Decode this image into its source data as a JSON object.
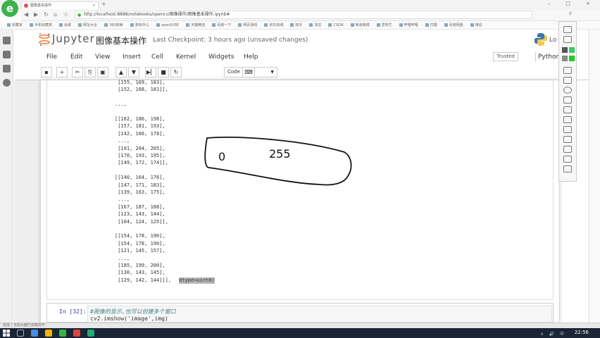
{
  "browser": {
    "logo_letter": "e",
    "tab_title": "图像基本操作",
    "tab_close": "×",
    "new_tab": "+",
    "window_controls": "– □ ×",
    "url": "http://localhost:8888/notebooks/opencv/图像操作/图像基本操作.ipynb#",
    "bookmarks": [
      "收藏夹",
      "手机收藏夹",
      "谷歌",
      "网址大全",
      "360搜索",
      "游戏中心",
      "openSUSE",
      "天猫精选",
      "百度一下",
      "网页游戏",
      "京东商城",
      "知乎",
      "淘宝",
      "CSDN",
      "新浪微博",
      "爱奇艺",
      "哔哩哔哩",
      "优酷",
      "百度网盘",
      "微信"
    ]
  },
  "jupyter": {
    "logo_text": "Jupyter",
    "notebook_title": "图像基本操作",
    "checkpoint": "Last Checkpoint: 3 hours ago (unsaved changes)",
    "logout": "Lo",
    "menu": [
      "File",
      "Edit",
      "View",
      "Insert",
      "Cell",
      "Kernel",
      "Widgets",
      "Help"
    ],
    "trusted": "Trusted",
    "kernel": "Python",
    "cell_type": "Code",
    "toolbar_icons": [
      "save-icon",
      "add-icon",
      "cut-icon",
      "copy-icon",
      "paste-icon",
      "move-up-icon",
      "move-down-icon",
      "run-icon",
      "stop-icon",
      "restart-icon",
      "keyboard-icon"
    ]
  },
  "output": {
    "lines": [
      " [155, 169, 183],",
      " [152, 168, 181]],",
      "",
      "...,",
      "",
      "[[162, 186, 198],",
      " [157, 181, 193],",
      " [142, 166, 178],",
      " ...,",
      " [191, 204, 205],",
      " [170, 193, 195],",
      " [149, 172, 174]],",
      "",
      "[[140, 164, 176],",
      " [147, 171, 183],",
      " [139, 163, 175],",
      " ...,",
      " [167, 187, 188],",
      " [123, 143, 144],",
      " [104, 124, 125]],",
      "",
      "[[154, 178, 190],",
      " [154, 178, 190],",
      " [121, 145, 157],",
      " ...,",
      " [185, 199, 200],",
      " [130, 143, 145],",
      " [129, 142, 144]]], "
    ],
    "dtype_text": "dtype=uint8)"
  },
  "annotation": {
    "text_left": "0",
    "text_right": "255"
  },
  "next_cell": {
    "prompt": "In [32]:",
    "comment": "#图像的显示,也可以创建多个窗口",
    "code": "cv2.imshow('image',img)"
  },
  "status_text": "完成 | 当前页面已加载完毕",
  "taskbar": {
    "time": "22:56",
    "tray": "∧ 🔊 中"
  }
}
